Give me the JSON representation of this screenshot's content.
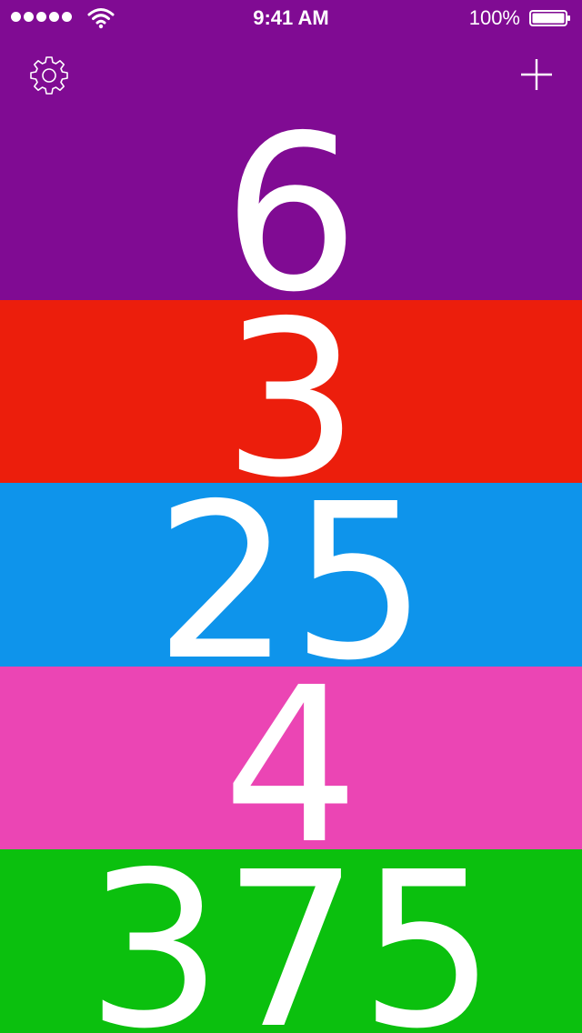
{
  "status_bar": {
    "time": "9:41 AM",
    "battery_percent": "100%",
    "signal_icon": "signal-dots-icon",
    "wifi_icon": "wifi-icon",
    "battery_icon": "battery-icon"
  },
  "toolbar": {
    "settings_icon": "gear-icon",
    "add_icon": "plus-icon"
  },
  "counters": [
    {
      "value": "6",
      "color": "#800B93"
    },
    {
      "value": "3",
      "color": "#EC1E0C"
    },
    {
      "value": "25",
      "color": "#0E94EB"
    },
    {
      "value": "4",
      "color": "#EB45B4"
    },
    {
      "value": "375",
      "color": "#0BC00E"
    }
  ]
}
